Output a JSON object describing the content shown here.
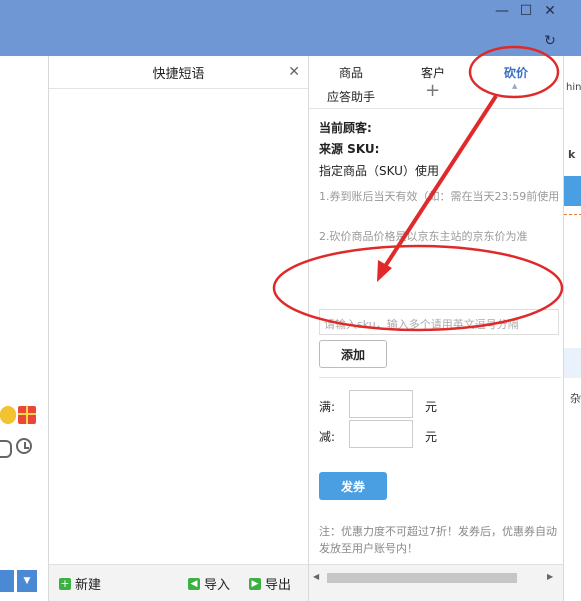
{
  "window": {
    "minimize": "—",
    "maximize": "☐",
    "close": "✕",
    "refresh": "↻"
  },
  "quick_phrases": {
    "title": "快捷短语",
    "close": "✕",
    "footer": {
      "new_label": "新建",
      "import_label": "导入",
      "export_label": "导出"
    }
  },
  "tabs": {
    "product": "商品",
    "customer": "客户",
    "bargain": "砍价",
    "reply_assistant": "应答助手",
    "add": "+"
  },
  "bargain_panel": {
    "current_customer_label": "当前顾客:",
    "source_sku_label": "来源 SKU:",
    "designated_product": "指定商品（SKU）使用",
    "note_1": "1.券到账后当天有效（如：需在当天23:59前使用",
    "note_2": "2.砍价商品价格是以京东主站的京东价为准",
    "sku_placeholder": "请输入sku，输入多个请用英文逗号分隔",
    "add_button": "添加",
    "full_label": "满:",
    "reduce_label": "减:",
    "unit": "元",
    "send_coupon_button": "发券",
    "footnote": "注：优惠力度不可超过7折！发券后，优惠券自动发放至用户账号内！"
  },
  "far_right_fragments": {
    "text_a": "hin",
    "text_b": "k",
    "text_c": "杂"
  },
  "colors": {
    "titlebar": "#6f97d4",
    "accent_blue": "#4a9fe3",
    "annotation_red": "#e02a2a",
    "green_icon": "#3cb043"
  },
  "icons": {
    "new": "plus-icon",
    "import": "import-arrow-icon",
    "export": "export-arrow-icon",
    "clock": "clock-icon",
    "gift": "gift-icon",
    "emoji": "smiley-icon"
  }
}
